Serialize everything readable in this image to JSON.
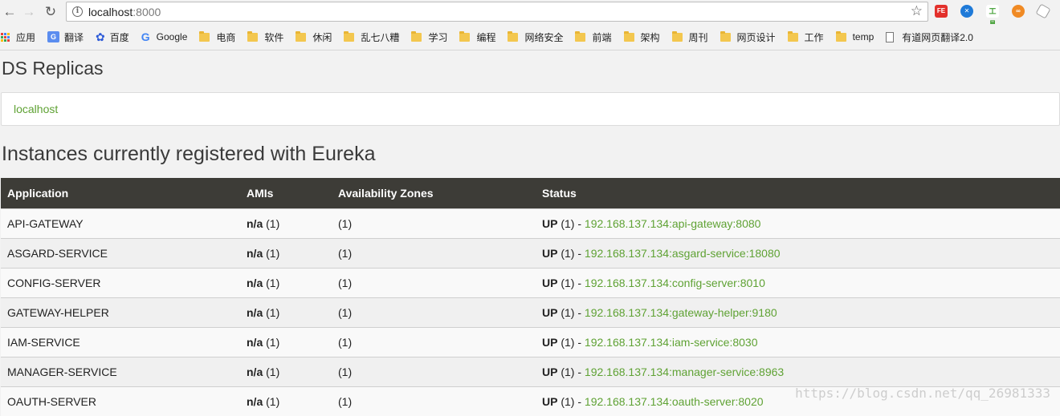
{
  "browser": {
    "url_host": "localhost",
    "url_port": ":8000",
    "extensions": [
      "FE",
      "",
      "工具",
      "",
      ""
    ]
  },
  "bookmarks": [
    {
      "label": "应用",
      "icon": "apps-icon"
    },
    {
      "label": "翻译",
      "icon": "translate-icon"
    },
    {
      "label": "百度",
      "icon": "baidu-icon"
    },
    {
      "label": "Google",
      "icon": "google-icon"
    },
    {
      "label": "电商",
      "icon": "folder-icon"
    },
    {
      "label": "软件",
      "icon": "folder-icon"
    },
    {
      "label": "休闲",
      "icon": "folder-icon"
    },
    {
      "label": "乱七八糟",
      "icon": "folder-icon"
    },
    {
      "label": "学习",
      "icon": "folder-icon"
    },
    {
      "label": "编程",
      "icon": "folder-icon"
    },
    {
      "label": "网络安全",
      "icon": "folder-icon"
    },
    {
      "label": "前端",
      "icon": "folder-icon"
    },
    {
      "label": "架构",
      "icon": "folder-icon"
    },
    {
      "label": "周刊",
      "icon": "folder-icon"
    },
    {
      "label": "网页设计",
      "icon": "folder-icon"
    },
    {
      "label": "工作",
      "icon": "folder-icon"
    },
    {
      "label": "temp",
      "icon": "folder-icon"
    },
    {
      "label": "有道网页翻译2.0",
      "icon": "document-icon"
    }
  ],
  "page": {
    "replicas_title": "DS Replicas",
    "replica_link": "localhost",
    "instances_title": "Instances currently registered with Eureka",
    "columns": [
      "Application",
      "AMIs",
      "Availability Zones",
      "Status"
    ],
    "rows": [
      {
        "app": "API-GATEWAY",
        "ami": "n/a",
        "ami_count": " (1)",
        "zones": "(1)",
        "status": "UP",
        "status_count": " (1) - ",
        "instance": "192.168.137.134:api-gateway:8080"
      },
      {
        "app": "ASGARD-SERVICE",
        "ami": "n/a",
        "ami_count": " (1)",
        "zones": "(1)",
        "status": "UP",
        "status_count": " (1) - ",
        "instance": "192.168.137.134:asgard-service:18080"
      },
      {
        "app": "CONFIG-SERVER",
        "ami": "n/a",
        "ami_count": " (1)",
        "zones": "(1)",
        "status": "UP",
        "status_count": " (1) - ",
        "instance": "192.168.137.134:config-server:8010"
      },
      {
        "app": "GATEWAY-HELPER",
        "ami": "n/a",
        "ami_count": " (1)",
        "zones": "(1)",
        "status": "UP",
        "status_count": " (1) - ",
        "instance": "192.168.137.134:gateway-helper:9180"
      },
      {
        "app": "IAM-SERVICE",
        "ami": "n/a",
        "ami_count": " (1)",
        "zones": "(1)",
        "status": "UP",
        "status_count": " (1) - ",
        "instance": "192.168.137.134:iam-service:8030"
      },
      {
        "app": "MANAGER-SERVICE",
        "ami": "n/a",
        "ami_count": " (1)",
        "zones": "(1)",
        "status": "UP",
        "status_count": " (1) - ",
        "instance": "192.168.137.134:manager-service:8963"
      },
      {
        "app": "OAUTH-SERVER",
        "ami": "n/a",
        "ami_count": " (1)",
        "zones": "(1)",
        "status": "UP",
        "status_count": " (1) - ",
        "instance": "192.168.137.134:oauth-server:8020"
      }
    ]
  },
  "watermark": "https://blog.csdn.net/qq_26981333",
  "colors": {
    "header_bg": "#3d3c37",
    "link_green": "#5fa234",
    "page_bg": "#f2f2f2"
  }
}
